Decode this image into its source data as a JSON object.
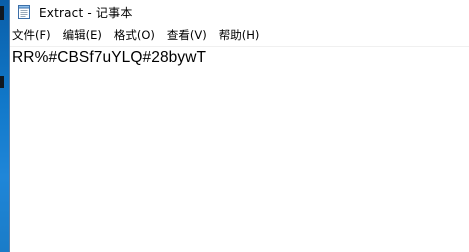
{
  "window": {
    "title": "Extract - 记事本"
  },
  "menu": {
    "items": [
      {
        "label": "文件(F)"
      },
      {
        "label": "编辑(E)"
      },
      {
        "label": "格式(O)"
      },
      {
        "label": "查看(V)"
      },
      {
        "label": "帮助(H)"
      }
    ]
  },
  "editor": {
    "content": "RR%#CBSf7uYLQ#28bywT"
  },
  "icons": {
    "app": "notepad-icon"
  },
  "colors": {
    "desktop_blue": "#1178c9",
    "window_border": "#5a7fa8",
    "background": "#ffffff",
    "text": "#000000"
  }
}
